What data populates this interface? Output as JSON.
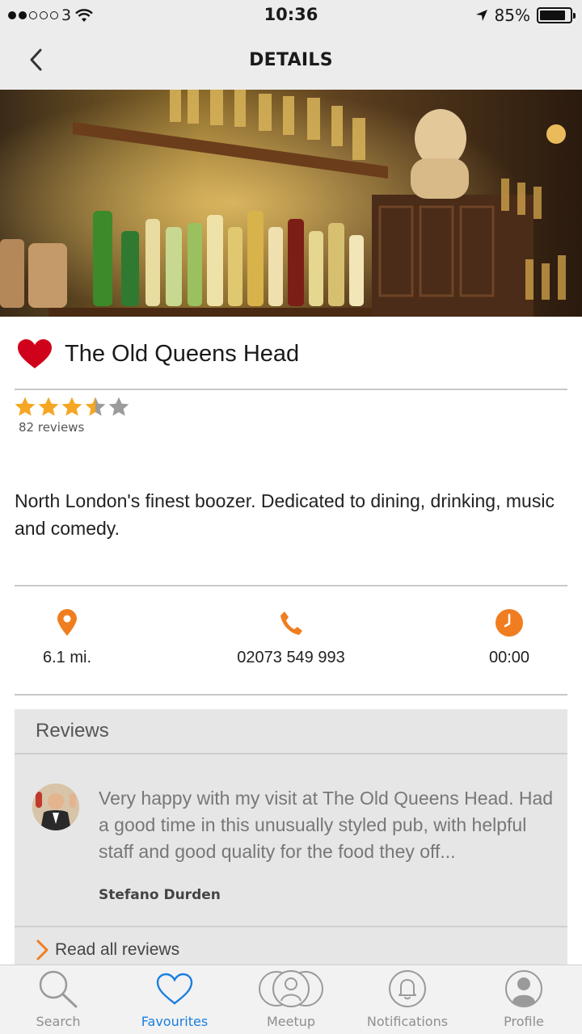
{
  "status_bar": {
    "carrier": "3",
    "time": "10:36",
    "battery": "85%",
    "battery_level": 0.85
  },
  "nav": {
    "title": "DETAILS"
  },
  "place": {
    "name": "The Old Queens Head",
    "rating": 3.5,
    "rating_max": 5,
    "reviews_count": "82 reviews",
    "description": "North London's finest boozer. Dedicated to dining, drinking, music and comedy."
  },
  "info": {
    "distance": "6.1 mi.",
    "phone": "02073 549 993",
    "time": "00:00"
  },
  "reviews": {
    "header": "Reviews",
    "items": [
      {
        "text": "Very happy with my visit at The Old Queens Head. Had a good time in this unusually styled pub, with helpful staff and good quality for the food they off...",
        "author": "Stefano Durden"
      }
    ],
    "read_all": "Read all reviews"
  },
  "tabs": [
    {
      "label": "Search",
      "icon": "search-icon",
      "active": false
    },
    {
      "label": "Favourites",
      "icon": "heart-icon",
      "active": true
    },
    {
      "label": "Meetup",
      "icon": "group-icon",
      "active": false
    },
    {
      "label": "Notifications",
      "icon": "bell-icon",
      "active": false
    },
    {
      "label": "Profile",
      "icon": "profile-icon",
      "active": false
    }
  ],
  "colors": {
    "accent": "#f07d1f",
    "star": "#f5a623",
    "star_empty": "#9b9b9b",
    "heart": "#d0021b",
    "tab_active": "#1a7fe0"
  }
}
